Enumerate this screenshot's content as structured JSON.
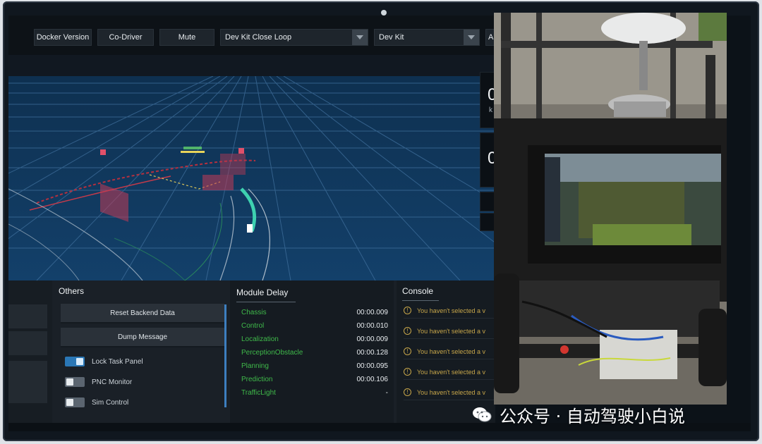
{
  "toolbar": {
    "docker_version": "Docker Version",
    "co_driver": "Co-Driver",
    "mute": "Mute",
    "mode_select": "Dev Kit Close Loop",
    "vehicle_select": "Dev Kit",
    "extra_select": "A"
  },
  "dashboard": {
    "speed_value": "0",
    "speed_unit": "k",
    "steering_value": "0"
  },
  "others": {
    "title": "Others",
    "reset_button": "Reset Backend Data",
    "dump_button": "Dump Message",
    "toggles": [
      {
        "label": "Lock Task Panel",
        "state": "on"
      },
      {
        "label": "PNC Monitor",
        "state": "off"
      },
      {
        "label": "Sim Control",
        "state": "off"
      }
    ]
  },
  "module_delay": {
    "title": "Module Delay",
    "rows": [
      {
        "name": "Chassis",
        "value": "00:00.009"
      },
      {
        "name": "Control",
        "value": "00:00.010"
      },
      {
        "name": "Localization",
        "value": "00:00.009"
      },
      {
        "name": "PerceptionObstacle",
        "value": "00:00.128"
      },
      {
        "name": "Planning",
        "value": "00:00.095"
      },
      {
        "name": "Prediction",
        "value": "00:00.106"
      },
      {
        "name": "TrafficLight",
        "value": "-"
      }
    ]
  },
  "console": {
    "title": "Console",
    "messages": [
      "You haven't selected a v",
      "You haven't selected a v",
      "You haven't selected a v",
      "You haven't selected a v",
      "You haven't selected a v"
    ]
  },
  "watermark": {
    "text": "公众号 · 自动驾驶小白说"
  },
  "colors": {
    "scene_bg": "#0f3558",
    "grid": "#3f6f9c",
    "accent_blue": "#2a77b6",
    "delay_green": "#3fb94a",
    "warn_yellow": "#c7a64a"
  }
}
